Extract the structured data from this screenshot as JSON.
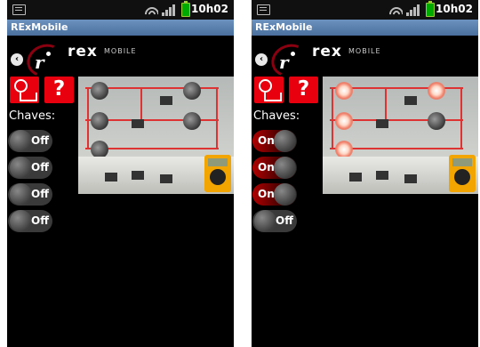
{
  "status": {
    "time": "10h02"
  },
  "app": {
    "title": "RExMobile",
    "logo_text": "rex",
    "logo_subtext": "MOBILE"
  },
  "help_label": "?",
  "switches_label": "Chaves:",
  "screens": [
    {
      "switches": [
        {
          "state": "off",
          "label": "Off"
        },
        {
          "state": "off",
          "label": "Off"
        },
        {
          "state": "off",
          "label": "Off"
        },
        {
          "state": "off",
          "label": "Off"
        }
      ],
      "lamps_lit": false
    },
    {
      "switches": [
        {
          "state": "on",
          "label": "On"
        },
        {
          "state": "on",
          "label": "On"
        },
        {
          "state": "on",
          "label": "On"
        },
        {
          "state": "off",
          "label": "Off"
        }
      ],
      "lamps_lit": true
    }
  ],
  "icons": {
    "lamp": "lamp-circuit-icon",
    "help": "help-icon",
    "back": "back-arrow-icon",
    "notification": "notification-icon",
    "wifi": "wifi-icon",
    "signal": "signal-icon",
    "battery": "battery-icon"
  },
  "colors": {
    "accent_red": "#e8000f",
    "titlebar": "#5b80ae",
    "on_red": "#b00000"
  }
}
